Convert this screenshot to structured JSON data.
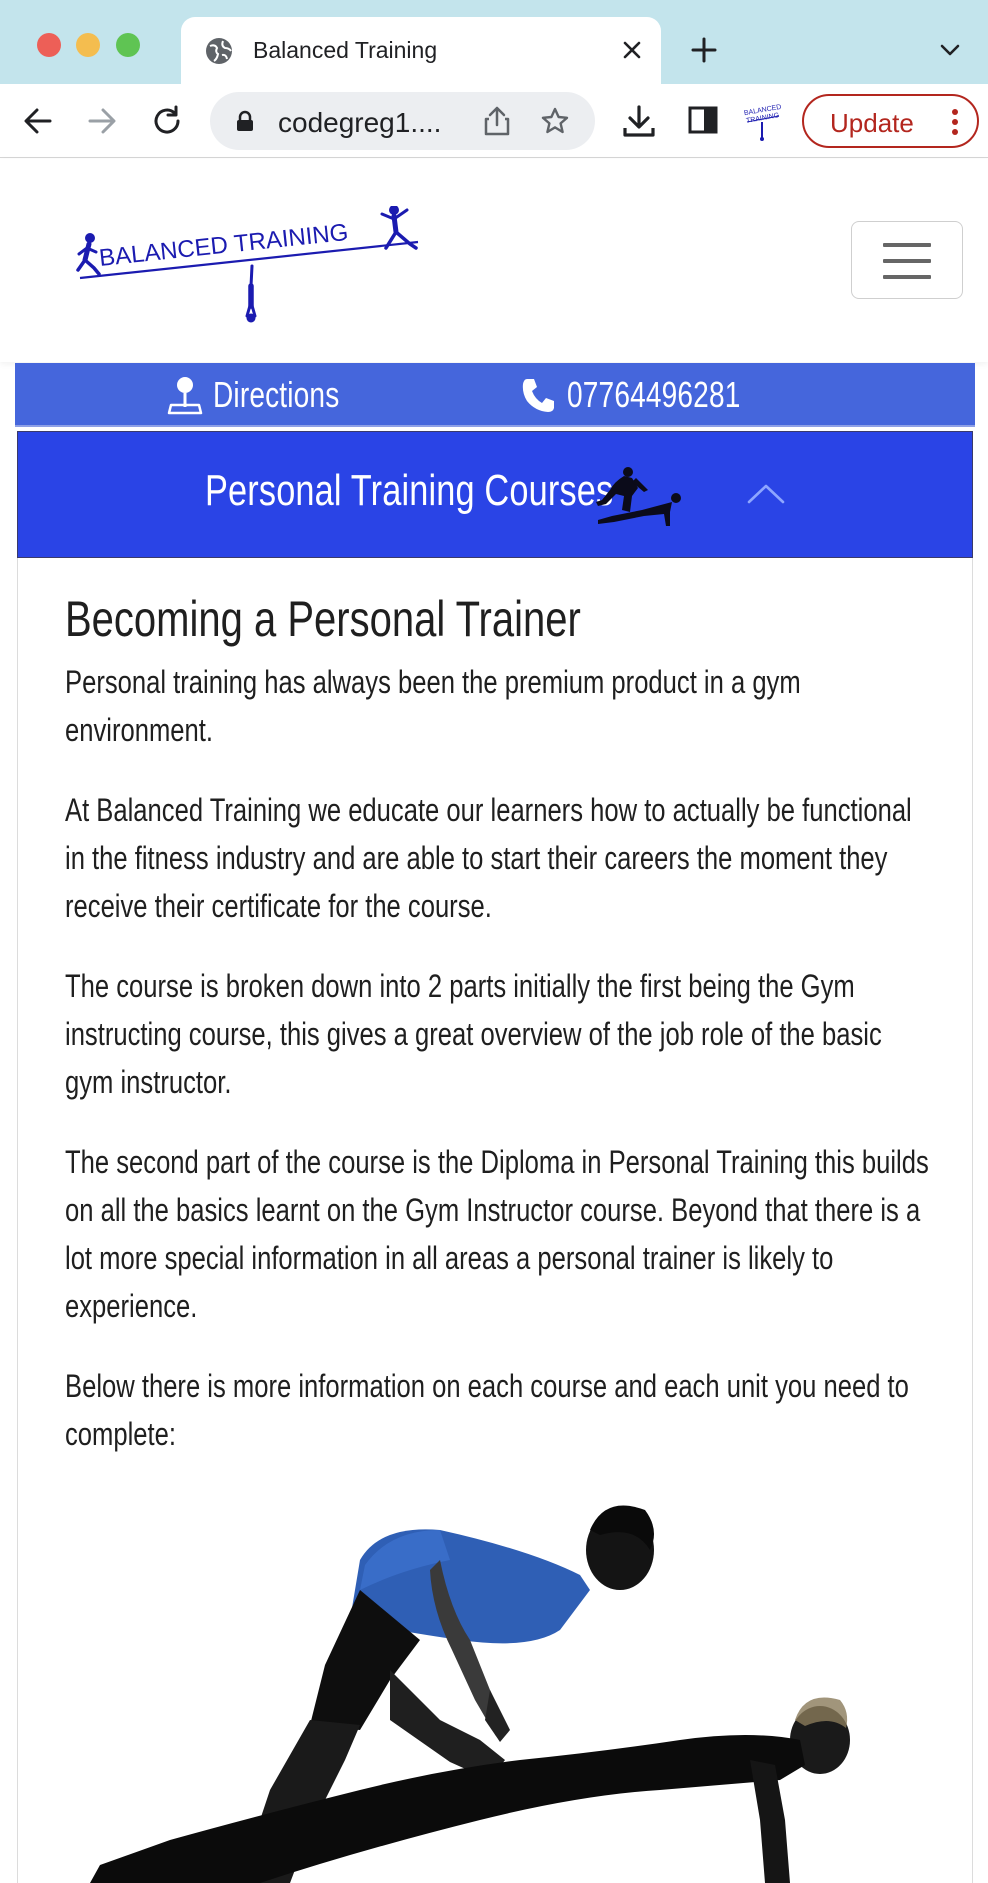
{
  "browser": {
    "tab_title": "Balanced Training",
    "url": "codegreg1....",
    "update_label": "Update"
  },
  "site": {
    "contact": {
      "directions_label": "Directions",
      "phone_label": "07764496281"
    },
    "accordion": {
      "title": "Personal Training Courses"
    },
    "article": {
      "heading": "Becoming a Personal Trainer",
      "paragraphs": [
        "Personal training has always been the premium product in a gym environment.",
        "At Balanced Training we educate our learners how to actually be functional in the fitness industry and are able to start their careers the moment they receive their certificate for the course.",
        "The course is broken down into 2 parts initially the first being the Gym instructing course, this gives a great overview of the job role of the basic gym instructor.",
        "The second part of the course is the Diploma in Personal Training this builds on all the basics learnt on the Gym Instructor course. Beyond that there is a lot more special information in all areas a personal trainer is likely to experience.",
        "Below there is more information on each course and each unit you need to complete:"
      ]
    },
    "logo_text": "BALANCED TRAINING",
    "colors": {
      "brand_blue": "#2a44e6",
      "contact_bar": "#4566dc",
      "logo_navy": "#1b1bb0",
      "update_red": "#b3261e"
    }
  },
  "icons": {
    "globe": "globe-icon",
    "close": "close-icon",
    "back": "back-arrow-icon",
    "forward": "forward-arrow-icon",
    "reload": "reload-icon",
    "lock": "lock-icon",
    "share": "share-icon",
    "star": "star-icon",
    "download": "download-icon",
    "sidepanel": "side-panel-icon",
    "map_pin": "map-pin-icon",
    "phone": "phone-icon",
    "chevron_up": "chevron-up-icon"
  }
}
